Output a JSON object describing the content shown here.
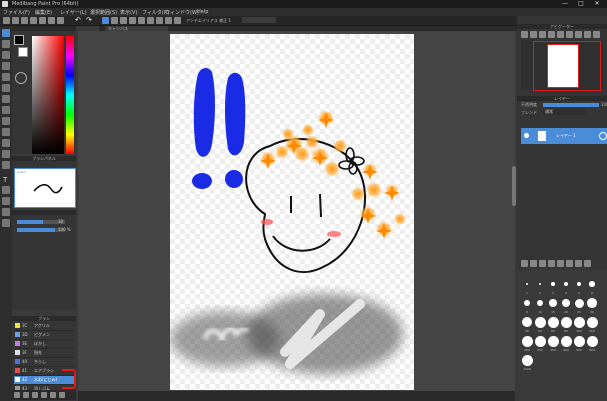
{
  "app": {
    "title": "Medibang Paint Pro (64bit)",
    "window_controls": [
      "—",
      "□",
      "✕"
    ]
  },
  "menu": [
    "ファイル(F)",
    "編集(E)",
    "レイヤー(L)",
    "選択範囲(S)",
    "表示(V)",
    "フィルタ(R)",
    "ウィンドウ(W)",
    "Help"
  ],
  "toolbar": {
    "icons": [
      "new-icon",
      "open-icon",
      "save-icon",
      "cloud-icon",
      "share-icon",
      "settings-icon",
      "undo-icon",
      "redo-icon",
      "stabilizer-icon",
      "grid-icon",
      "snap-off-icon",
      "snap-parallel-icon",
      "snap-cross-icon",
      "snap-radial-icon",
      "snap-circle-icon",
      "snap-curve-icon"
    ],
    "hint": "アンチエイリアス  補正 1"
  },
  "canvas_tab": {
    "label": "キャンバス"
  },
  "left_panels": {
    "color": {
      "hex": "#000000",
      "bg_hex": "#ffffff"
    },
    "subtool": {
      "header": "ブラシパネル",
      "brush_name": "G-Pen"
    },
    "properties": {
      "size_label": "30",
      "opacity_label": "100 %"
    },
    "layers": {
      "header": "ブラシ",
      "rows": [
        {
          "code": "3C",
          "name": "アクリル",
          "color": "#f0e040"
        },
        {
          "code": "3D",
          "name": "ピグメン",
          "color": "#6aa2e0"
        },
        {
          "code": "3E",
          "name": "ぼかし",
          "color": "#cc7ae0"
        },
        {
          "code": "3F",
          "name": "指先",
          "color": "#e0e0e0"
        },
        {
          "code": "40",
          "name": "ちらし",
          "color": "#5070e0"
        },
        {
          "code": "41",
          "name": "エアブラシ",
          "color": "#e05050"
        },
        {
          "code": "42",
          "name": "水彩(にじみ)",
          "color": "#ffffff",
          "selected": true
        },
        {
          "code": "43",
          "name": "消しゴム",
          "color": "#999999"
        }
      ]
    }
  },
  "right_panels": {
    "navigator": {
      "header": "ナビゲーター"
    },
    "layer": {
      "header": "レイヤー",
      "mode_label": "不透明度",
      "blend_label": "通常",
      "opacity": "100",
      "layer_name": "レイヤー 1"
    },
    "brush_size": {
      "header": "ブラシサイズ",
      "sizes": [
        "1",
        "2",
        "3",
        "4",
        "5",
        "6",
        "8",
        "10",
        "15",
        "20",
        "25",
        "30",
        "40",
        "50",
        "60",
        "80",
        "100",
        "150",
        "200",
        "250",
        "300",
        "400",
        "500",
        "800",
        "1000"
      ]
    }
  }
}
